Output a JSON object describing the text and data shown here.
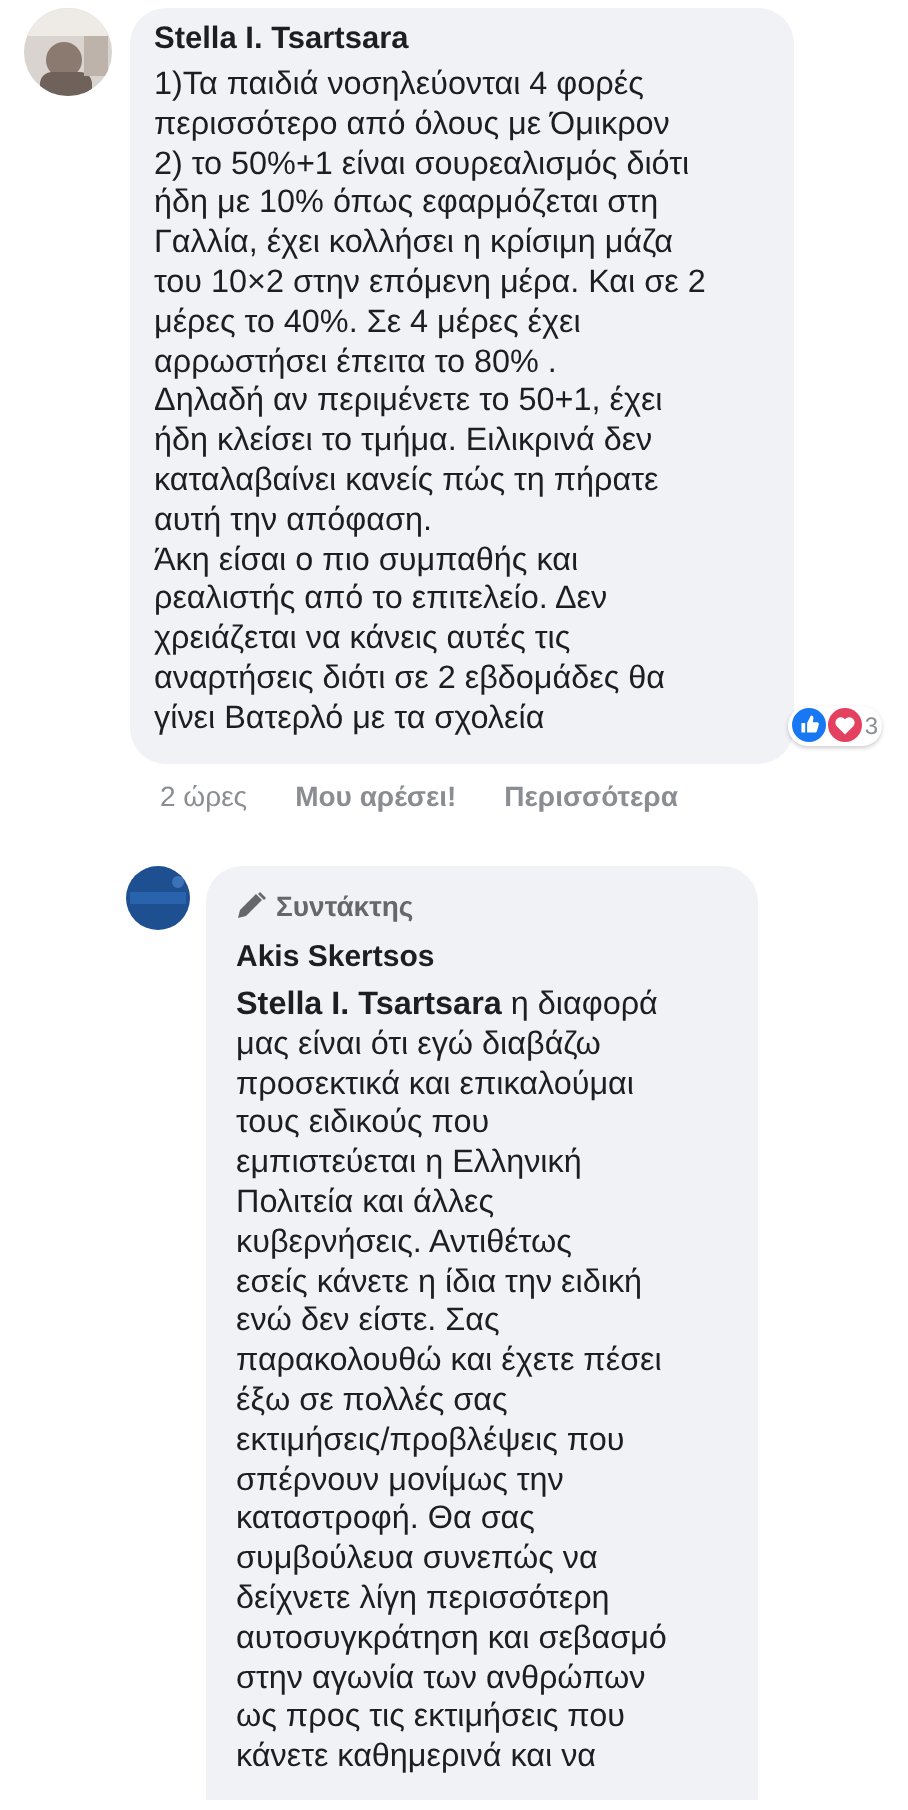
{
  "comments": [
    {
      "kind": "comment",
      "author": "Stella I. Tsartsara",
      "lines": [
        "1)Τα παιδιά νοσηλεύονται 4 φορές",
        "περισσότερο από όλους με Όμικρον",
        "2) το 50%+1 είναι σουρεαλισμός διότι",
        "ήδη με 10% όπως εφαρμόζεται στη",
        "Γαλλία, έχει κολλήσει η κρίσιμη μάζα",
        "του 10×2 στην επόμενη μέρα. Και σε 2",
        "μέρες το 40%. Σε 4 μέρες έχει",
        "αρρωστήσει έπειτα το 80% .",
        "Δηλαδή αν περιμένετε το 50+1, έχει",
        "ήδη κλείσει το τμήμα. Ειλικρινά δεν",
        "καταλαβαίνει κανείς πώς τη πήρατε",
        "αυτή την απόφαση.",
        "Άκη είσαι ο πιο συμπαθής και",
        "ρεαλιστής από το επιτελείο. Δεν",
        "χρειάζεται να κάνεις αυτές τις",
        "αναρτήσεις διότι σε 2 εβδομάδες θα",
        "γίνει Βατερλό με τα σχολεία"
      ],
      "reactions_count": "3",
      "time": "2 ώρες",
      "like": "Μου αρέσει!",
      "more": "Περισσότερα"
    },
    {
      "kind": "reply",
      "badge": "Συντάκτης",
      "author": "Akis Skertsos",
      "lines": [
        "**Stella I. Tsartsara** η διαφορά",
        "μας είναι ότι εγώ διαβάζω",
        "προσεκτικά και επικαλούμαι",
        "τους ειδικούς που",
        "εμπιστεύεται η Ελληνική",
        "Πολιτεία και άλλες",
        "κυβερνήσεις. Αντιθέτως",
        "εσείς κάνετε η ίδια την ειδική",
        "ενώ δεν είστε. Σας",
        "παρακολουθώ και έχετε πέσει",
        "έξω σε πολλές σας",
        "εκτιμήσεις/προβλέψεις που",
        "σπέρνουν μονίμως την",
        "καταστροφή. Θα σας",
        "συμβούλευα συνεπώς να",
        "δείχνετε λίγη περισσότερη",
        "αυτοσυγκράτηση και σεβασμό",
        "στην αγωνία των ανθρώπων",
        "ως προς τις εκτιμήσεις που",
        "κάνετε καθημερινά και να"
      ]
    }
  ]
}
